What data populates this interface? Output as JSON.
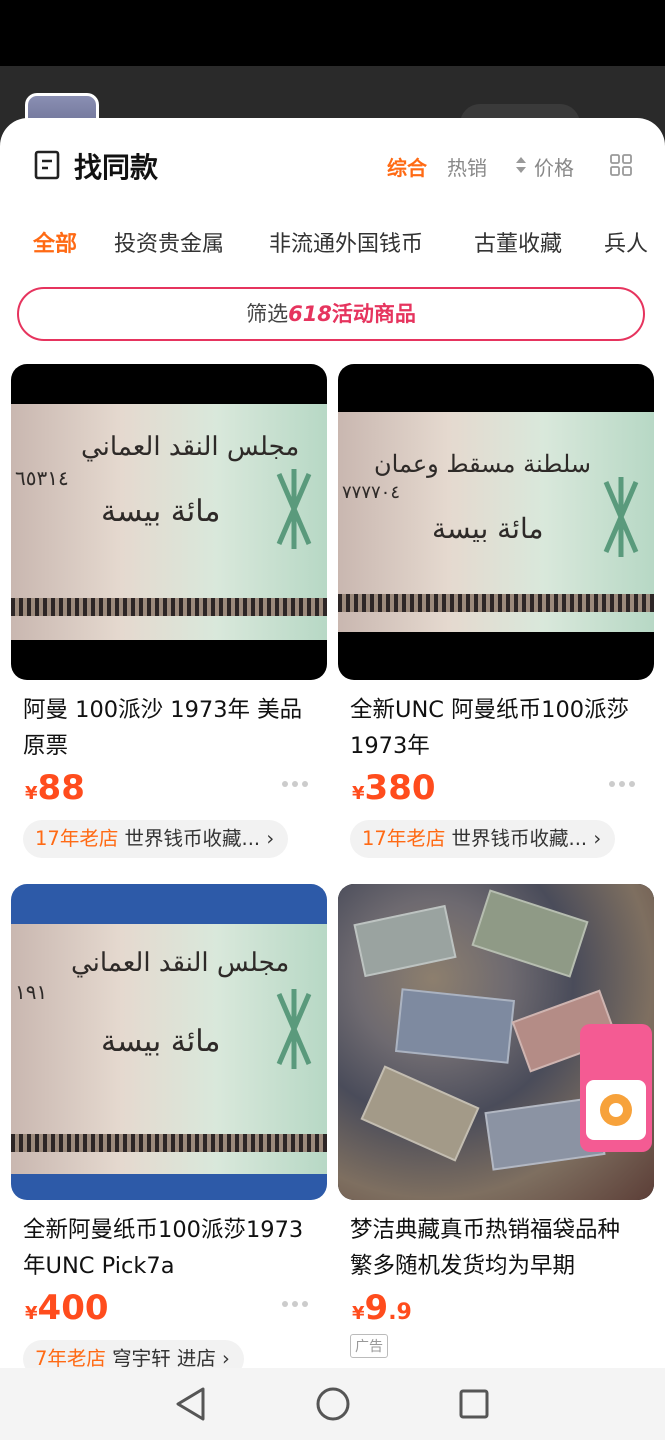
{
  "header": {
    "title": "找同款",
    "sort_comprehensive": "综合",
    "sort_hot": "热销",
    "sort_price": "价格"
  },
  "categories": [
    "全部",
    "投资贵金属",
    "非流通外国钱币",
    "古董收藏",
    "兵人"
  ],
  "filter_banner": {
    "prefix": "筛选",
    "highlight": "618",
    "suffix": "活动商品"
  },
  "products": [
    {
      "title": "阿曼 100派沙 1973年 美品原票",
      "currency": "¥",
      "price": "88",
      "price_decimal": "",
      "shop_age": "17年老店",
      "shop_name": "世界钱币收藏...",
      "arrow": "›",
      "ad_label": "",
      "bill_line1": "مجلس النقد العماني",
      "bill_line2": "مائة بيسة",
      "bill_number": "٦٥٣١٤"
    },
    {
      "title": "全新UNC 阿曼纸币100派莎1973年",
      "currency": "¥",
      "price": "380",
      "price_decimal": "",
      "shop_age": "17年老店",
      "shop_name": "世界钱币收藏...",
      "arrow": "›",
      "ad_label": "",
      "bill_line1": "سلطنة مسقط وعمان",
      "bill_line2": "مائة بيسة",
      "bill_number": "٧٧٧٧٠٤"
    },
    {
      "title": "全新阿曼纸币100派莎1973年UNC Pick7a",
      "currency": "¥",
      "price": "400",
      "price_decimal": "",
      "shop_age": "7年老店",
      "shop_name": "穹宇轩 进店",
      "arrow": "›",
      "ad_label": "",
      "bill_line1": "مجلس النقد العماني",
      "bill_line2": "مائة بيسة",
      "bill_number": "١٩١"
    },
    {
      "title": "梦洁典藏真币热销福袋品种繁多随机发货均为早期",
      "currency": "¥",
      "price": "9",
      "price_decimal": ".9",
      "shop_age": "",
      "shop_name": "",
      "arrow": "",
      "ad_label": "广告",
      "bill_line1": "",
      "bill_line2": "",
      "bill_number": ""
    }
  ],
  "colors": {
    "accent": "#ff6a14",
    "price": "#ff4c1d",
    "promo": "#e6345e"
  },
  "icons": [
    "list-icon",
    "sort-arrows-icon",
    "grid-view-icon",
    "more-dots-icon",
    "back-nav-icon",
    "home-nav-icon",
    "recents-nav-icon"
  ]
}
